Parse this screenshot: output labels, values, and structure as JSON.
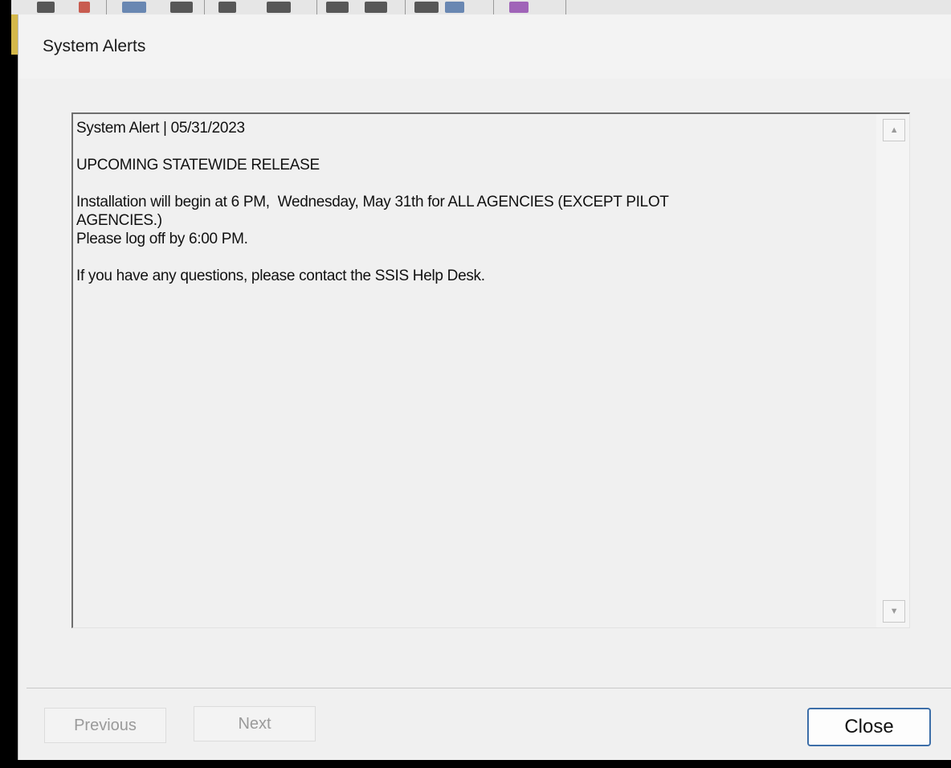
{
  "window": {
    "title": "System Alerts"
  },
  "alert": {
    "lines": [
      "System Alert | 05/31/2023",
      "",
      "UPCOMING STATEWIDE RELEASE",
      "",
      "Installation will begin at 6 PM,  Wednesday, May 31th for ALL AGENCIES (EXCEPT PILOT",
      "AGENCIES.)",
      "Please log off by 6:00 PM.",
      "",
      "If you have any questions, please contact the SSIS Help Desk."
    ]
  },
  "buttons": {
    "previous_label": "Previous",
    "next_label": "Next",
    "close_label": "Close"
  },
  "icons": {
    "scroll_up": "scroll-up-arrow-icon",
    "scroll_down": "scroll-down-arrow-icon"
  }
}
